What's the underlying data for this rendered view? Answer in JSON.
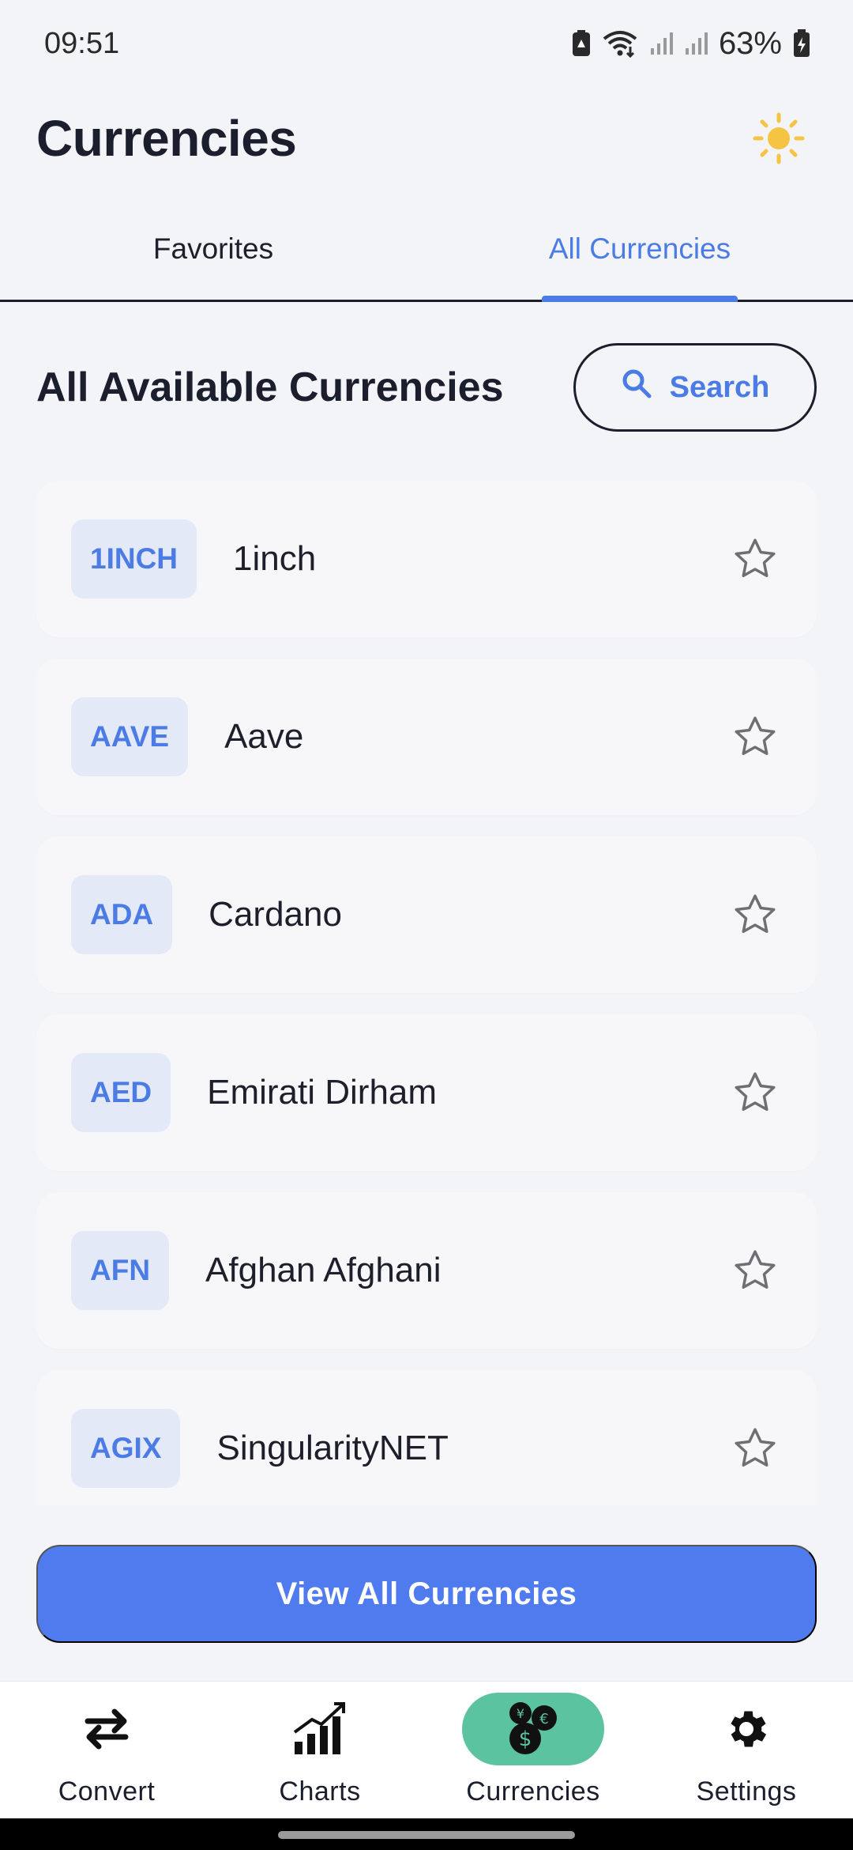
{
  "status_bar": {
    "time": "09:51",
    "battery_percent": "63%",
    "icons": [
      "battery-saver-icon",
      "wifi-icon",
      "signal-icon",
      "signal-icon",
      "battery-icon"
    ]
  },
  "header": {
    "title": "Currencies",
    "theme_icon": "sun-icon"
  },
  "tabs": [
    {
      "label": "Favorites",
      "active": false
    },
    {
      "label": "All Currencies",
      "active": true
    }
  ],
  "section": {
    "title": "All Available Currencies",
    "search_label": "Search",
    "search_icon": "search-icon"
  },
  "currencies": [
    {
      "code": "1INCH",
      "name": "1inch",
      "favorite": false
    },
    {
      "code": "AAVE",
      "name": "Aave",
      "favorite": false
    },
    {
      "code": "ADA",
      "name": "Cardano",
      "favorite": false
    },
    {
      "code": "AED",
      "name": "Emirati Dirham",
      "favorite": false
    },
    {
      "code": "AFN",
      "name": "Afghan Afghani",
      "favorite": false
    },
    {
      "code": "AGIX",
      "name": "SingularityNET",
      "favorite": false
    }
  ],
  "view_all_label": "View All Currencies",
  "bottom_nav": [
    {
      "label": "Convert",
      "icon": "swap-arrows-icon",
      "active": false
    },
    {
      "label": "Charts",
      "icon": "chart-icon",
      "active": false
    },
    {
      "label": "Currencies",
      "icon": "coins-icon",
      "active": true
    },
    {
      "label": "Settings",
      "icon": "gear-icon",
      "active": false
    }
  ],
  "colors": {
    "accent": "#4B7BE5",
    "primary_button": "#507BEF",
    "nav_active": "#5BC3A0",
    "badge_bg": "#E4E9F8",
    "background": "#F3F4F8",
    "sun": "#F6C443"
  }
}
